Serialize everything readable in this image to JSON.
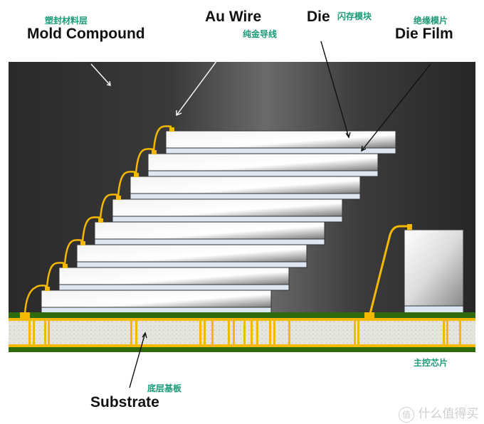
{
  "labels": {
    "mold_cn": "塑封材料层",
    "mold_en": "Mold Compound",
    "wire_en": "Au Wire",
    "wire_cn": "纯金导线",
    "die_en": "Die",
    "die_cn": "闪存模块",
    "film_cn": "绝缘模片",
    "film_en": "Die Film",
    "controller_cn": "主控芯片",
    "substrate_cn": "底层基板",
    "substrate_en": "Substrate"
  },
  "watermark": {
    "logo_glyph": "值",
    "text": "什么值得买"
  },
  "die_stack_count": 8,
  "colors": {
    "mold": "#2b2b2b",
    "wire": "#f5b800",
    "green": "#2f6b0a",
    "label_cn": "#1a9a78",
    "film": "#dde7f4"
  }
}
